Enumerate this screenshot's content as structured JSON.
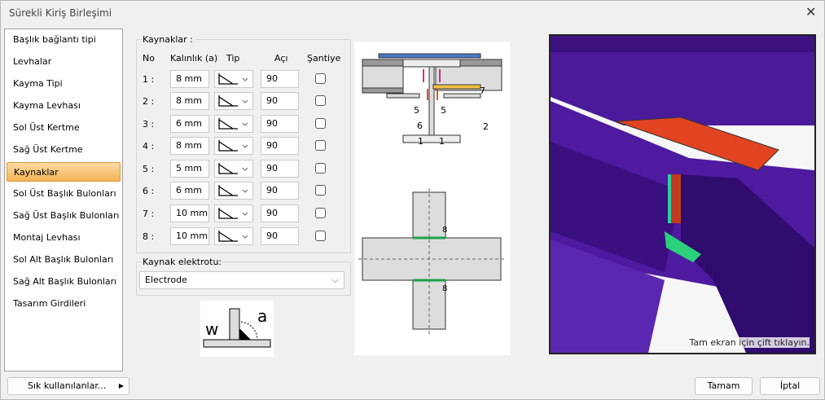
{
  "window": {
    "title": "Sürekli Kiriş Birleşimi"
  },
  "nav": {
    "items": [
      "Başlık bağlantı tipi",
      "Levhalar",
      "Kayma Tipi",
      "Kayma Levhası",
      "Sol Üst Kertme",
      "Sağ Üst Kertme",
      "Kaynaklar",
      "Sol Üst Başlık Bulonları",
      "Sağ Üst Başlık Bulonları",
      "Montaj Levhası",
      "Sol Alt Başlık Bulonları",
      "Sağ Alt Başlık Bulonları",
      "Tasarım Girdileri"
    ],
    "selected": "Kaynaklar"
  },
  "welds": {
    "group_label": "Kaynaklar :",
    "headers": {
      "no": "No",
      "thickness": "Kalınlık (a)",
      "type": "Tip",
      "angle": "Açı",
      "site": "Şantiye"
    },
    "rows": [
      {
        "no": "1 :",
        "thickness": "8 mm",
        "type": "fillet-weld-icon",
        "angle": "90",
        "site": false
      },
      {
        "no": "2 :",
        "thickness": "8 mm",
        "type": "fillet-weld-icon",
        "angle": "90",
        "site": false
      },
      {
        "no": "3 :",
        "thickness": "6 mm",
        "type": "fillet-weld-icon",
        "angle": "90",
        "site": false
      },
      {
        "no": "4 :",
        "thickness": "8 mm",
        "type": "fillet-weld-icon",
        "angle": "90",
        "site": false
      },
      {
        "no": "5 :",
        "thickness": "5 mm",
        "type": "fillet-weld-icon",
        "angle": "90",
        "site": false
      },
      {
        "no": "6 :",
        "thickness": "6 mm",
        "type": "fillet-weld-icon",
        "angle": "90",
        "site": false
      },
      {
        "no": "7 :",
        "thickness": "10 mm",
        "type": "fillet-weld-icon",
        "angle": "90",
        "site": false
      },
      {
        "no": "8 :",
        "thickness": "10 mm",
        "type": "fillet-weld-icon",
        "angle": "90",
        "site": false
      }
    ]
  },
  "electrode": {
    "label": "Kaynak elektrotu:",
    "value": "Electrode"
  },
  "weld_sketch": {
    "w": "w",
    "a": "a"
  },
  "diagram": {
    "labels": [
      "7",
      "5",
      "5",
      "6",
      "2",
      "1",
      "1",
      "8",
      "8"
    ]
  },
  "view3d": {
    "hint": "Tam ekran için çift tıklayın."
  },
  "footer": {
    "favorites": "Sık kullanılanlar...",
    "ok": "Tamam",
    "cancel": "İptal"
  }
}
